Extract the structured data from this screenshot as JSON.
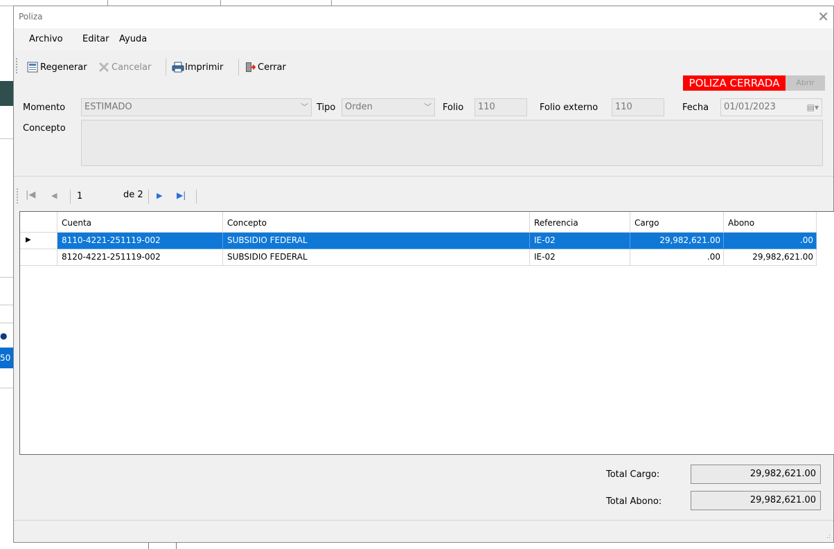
{
  "window": {
    "title": "Poliza"
  },
  "menu": {
    "archivo": "Archivo",
    "editar": "Editar",
    "ayuda": "Ayuda"
  },
  "toolbar": {
    "regenerar": "Regenerar",
    "cancelar": "Cancelar",
    "imprimir": "Imprimir",
    "cerrar": "Cerrar"
  },
  "status": {
    "cerrada": "POLIZA CERRADA",
    "abrir": "Abrir"
  },
  "form": {
    "momento_label": "Momento",
    "momento_value": "ESTIMADO",
    "tipo_label": "Tipo",
    "tipo_value": "Orden",
    "folio_label": "Folio",
    "folio_value": "110",
    "folio_externo_label": "Folio externo",
    "folio_externo_value": "110",
    "fecha_label": "Fecha",
    "fecha_value": "01/01/2023",
    "concepto_label": "Concepto",
    "concepto_value": ""
  },
  "navigator": {
    "position": "1",
    "of_text": "de 2"
  },
  "grid": {
    "columns": [
      "Cuenta",
      "Concepto",
      "Referencia",
      "Cargo",
      "Abono"
    ],
    "rows": [
      {
        "cuenta": "8110-4221-251119-002",
        "concepto": "SUBSIDIO FEDERAL",
        "referencia": "IE-02",
        "cargo": "29,982,621.00",
        "abono": ".00"
      },
      {
        "cuenta": "8120-4221-251119-002",
        "concepto": "SUBSIDIO FEDERAL",
        "referencia": "IE-02",
        "cargo": ".00",
        "abono": "29,982,621.00"
      }
    ]
  },
  "totals": {
    "cargo_label": "Total Cargo:",
    "cargo_value": "29,982,621.00",
    "abono_label": "Total Abono:",
    "abono_value": "29,982,621.00"
  },
  "background": {
    "row_fragment": "50"
  },
  "colors": {
    "selection": "#0f78d7",
    "closed_badge": "#ff0000"
  }
}
